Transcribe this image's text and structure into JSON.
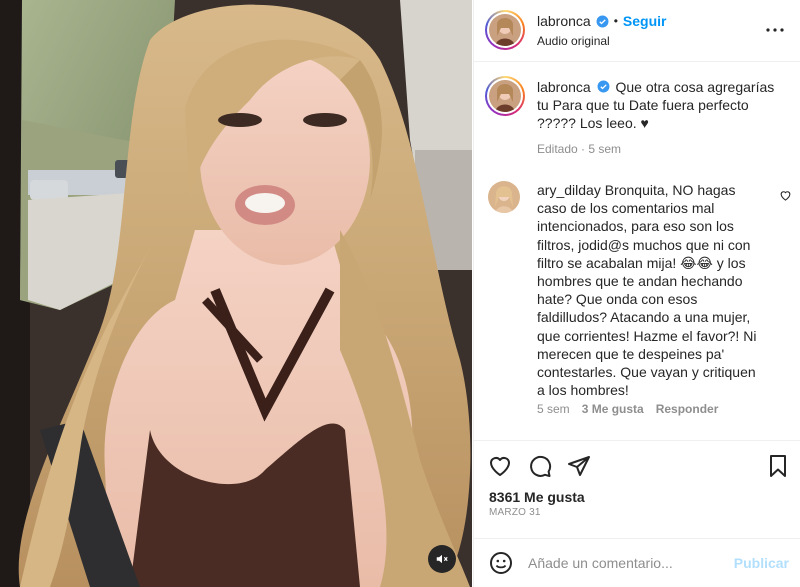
{
  "post": {
    "username": "labronca",
    "follow_label": "Seguir",
    "audio_label": "Audio original",
    "separator": "•"
  },
  "caption": {
    "username": "labronca",
    "text": "Que otra cosa agregarías tu Para que tu Date fuera perfecto ????? Los leeo. ♥",
    "edited": "Editado · 5 sem"
  },
  "comment": {
    "username": "ary_dilday",
    "text": "Bronquita, NO hagas caso de los comentarios mal intencionados, para eso son los filtros, jodid@s muchos que ni con filtro se acabalan mija! 😂😂 y los hombres que te andan hechando hate? Que onda con esos faldilludos? Atacando a una mujer, que corrientes! Hazme el favor?! Ni merecen que te despeines pa' contestarles. Que vayan y critiquen a los hombres!",
    "time": "5 sem",
    "likes": "3 Me gusta",
    "reply_label": "Responder"
  },
  "actions": {
    "likes": "8361 Me gusta",
    "date": "MARZO 31"
  },
  "add_comment": {
    "placeholder": "Añade un comentario...",
    "publish_label": "Publicar"
  },
  "icons": {
    "more": "more-horizontal-icon",
    "like": "heart-icon",
    "comment": "comment-bubble-icon",
    "share": "paper-plane-icon",
    "save": "bookmark-icon",
    "emoji": "smiley-icon",
    "audio": "speaker-muted-icon",
    "verified": "verified-badge-icon"
  },
  "colors": {
    "accent": "#0095f6",
    "verified": "#3897f0",
    "publish_disabled": "#b2dffc",
    "secondary_text": "#8e8e8e"
  }
}
